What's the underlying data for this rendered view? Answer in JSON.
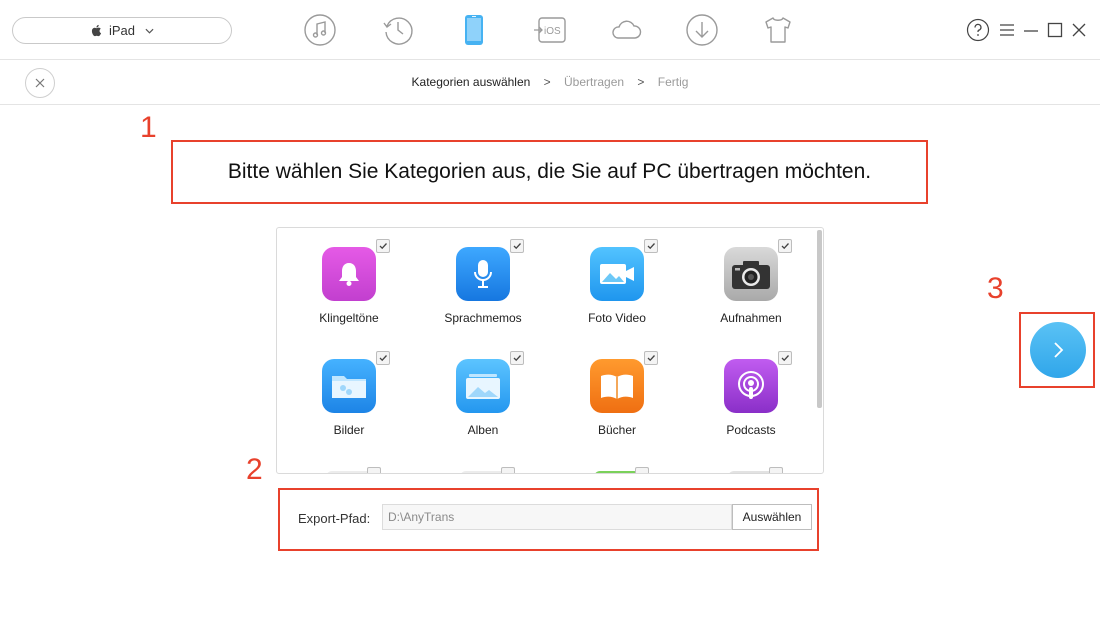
{
  "device": {
    "name": "iPad"
  },
  "toolbar": {
    "tools": [
      {
        "icon": "music-note-icon"
      },
      {
        "icon": "history-clock-icon"
      },
      {
        "icon": "phone-device-icon",
        "active": true
      },
      {
        "icon": "ios-transfer-icon",
        "text": "iOS"
      },
      {
        "icon": "cloud-icon"
      },
      {
        "icon": "download-icon"
      },
      {
        "icon": "tshirt-icon"
      }
    ],
    "window_controls": [
      "help-icon",
      "menu-icon",
      "minimize-icon",
      "maximize-icon",
      "close-window-icon"
    ]
  },
  "breadcrumb": {
    "steps": [
      "Kategorien auswählen",
      "Übertragen",
      "Fertig"
    ],
    "separator": ">",
    "active_index": 0
  },
  "annotations": {
    "marker_1": "1",
    "marker_2": "2",
    "marker_3": "3"
  },
  "headline": "Bitte wählen Sie Kategorien aus, die Sie auf PC übertragen möchten.",
  "categories": [
    {
      "label": "Klingeltöne",
      "icon": "bell-icon",
      "color": "#d148d9",
      "checked": true
    },
    {
      "label": "Sprachmemos",
      "icon": "microphone-icon",
      "color": "#1b8ff2",
      "checked": true
    },
    {
      "label": "Foto Video",
      "icon": "photo-video-icon",
      "color": "#2aa8f5",
      "checked": true
    },
    {
      "label": "Aufnahmen",
      "icon": "camera-icon",
      "color": "#3a3a3a",
      "checked": true
    },
    {
      "label": "Bilder",
      "icon": "folder-images-icon",
      "color": "#239bf0",
      "checked": true
    },
    {
      "label": "Alben",
      "icon": "albums-icon",
      "color": "#2ba4f4",
      "checked": true
    },
    {
      "label": "Bücher",
      "icon": "book-icon",
      "color": "#f5801f",
      "checked": true
    },
    {
      "label": "Podcasts",
      "icon": "podcast-icon",
      "color": "#9b3fd3",
      "checked": true
    }
  ],
  "export": {
    "label": "Export-Pfad:",
    "path": "D:\\AnyTrans",
    "button": "Auswählen"
  },
  "colors": {
    "accent": "#30a6ea",
    "annotation": "#e8412c"
  }
}
